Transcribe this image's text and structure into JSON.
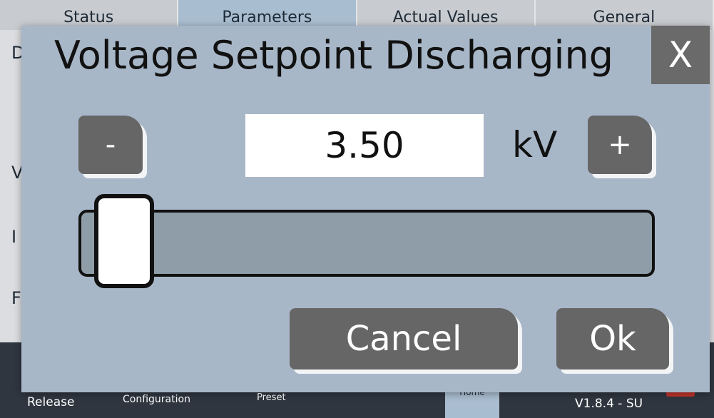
{
  "tabs": [
    {
      "label": "Status"
    },
    {
      "label": "Parameters"
    },
    {
      "label": "Actual Values"
    },
    {
      "label": "General"
    }
  ],
  "background_rows": [
    "D",
    "V",
    "I",
    "F"
  ],
  "footer": {
    "release": "Release",
    "configuration": "Configuration",
    "preset": "Preset",
    "home": "Home",
    "version": "V1.8.4 - SU"
  },
  "dialog": {
    "title": "Voltage Setpoint Discharging",
    "close_label": "X",
    "minus_label": "-",
    "plus_label": "+",
    "value": "3.50",
    "unit": "kV",
    "slider_level": 0.05,
    "cancel_label": "Cancel",
    "ok_label": "Ok"
  },
  "colors": {
    "dialog_bg": "#a8b7c8",
    "button_bg": "#666666",
    "active_tab": "#a9bdd0",
    "footer_bg": "#2f3640"
  }
}
